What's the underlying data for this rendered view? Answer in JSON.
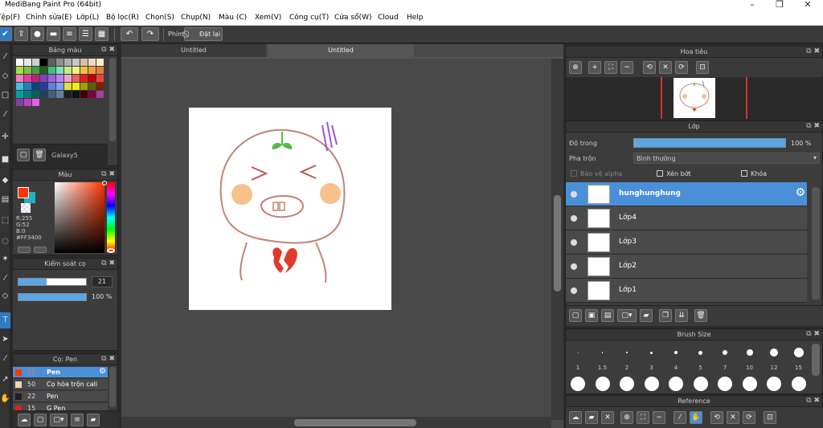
{
  "window": {
    "title": "MediBang Paint Pro (64bit)",
    "minimize": "–",
    "maximize": "❐",
    "close": "✕"
  },
  "menu": [
    "Tệp(F)",
    "Chỉnh sửa(E)",
    "Lớp(L)",
    "Bộ lọc(R)",
    "Chọn(S)",
    "Chụp(N)",
    "Màu (C)",
    "Xem(V)",
    "Công cụ(T)",
    "Cửa sổ(W)",
    "Cloud",
    "Help"
  ],
  "toolbar": {
    "snap_label": "Phím",
    "reset_label": "Đặt lại"
  },
  "tabs": [
    "Untitled",
    "Untitled"
  ],
  "palette": {
    "title": "Bảng màu",
    "set_name": "Galaxy5",
    "colors": [
      [
        "#ffffff",
        "#e8e8e8",
        "#d0d0d0",
        "#000000",
        "#606060",
        "#909090",
        "#b0b0b0",
        "#c8c8c8",
        "#d8c0a0",
        "#f0d8c0",
        "#f8f0c0"
      ],
      [
        "#a0e040",
        "#80c040",
        "#40a040",
        "#206020",
        "#40c080",
        "#80e0c0",
        "#c0f080",
        "#f0f080",
        "#f0c040",
        "#f0a040",
        "#e08040"
      ],
      [
        "#f080c0",
        "#e040a0",
        "#c02080",
        "#8040c0",
        "#a060e0",
        "#c080f0",
        "#f0a0c0",
        "#f06060",
        "#e02020",
        "#c00000",
        "#f04040"
      ],
      [
        "#40c0e0",
        "#2080c0",
        "#104080",
        "#2040a0",
        "#6080e0",
        "#80a0f0",
        "#e0e040",
        "#f0f000",
        "#a0a000",
        "#606000",
        "#802000"
      ],
      [
        "#00a0a0",
        "#008080",
        "#006060",
        "#204060",
        "#406080",
        "#6080a0",
        "#202020",
        "#101010",
        "#400000",
        "#800040",
        "#a040a0"
      ],
      [
        "#8040a0",
        "#c040c0",
        "#e060e0"
      ]
    ]
  },
  "color_panel": {
    "title": "Màu",
    "r": "R:255",
    "g": "G:52",
    "b": "B:0",
    "hex": "#FF3400",
    "primary": "#ff3400",
    "secondary": "#20b0c0"
  },
  "brush_control": {
    "title": "Kiểm soát cọ",
    "size_value": "21",
    "size_fraction": 0.42,
    "opacity_value": "100 %",
    "opacity_fraction": 1.0
  },
  "brush_list": {
    "title": "Cọ: Pen",
    "items": [
      {
        "size": "21",
        "name": "Pen",
        "selected": true,
        "color": "#ff3400"
      },
      {
        "size": "50",
        "name": "Cọ hòa trộn cali",
        "selected": false,
        "color": "#f0d8b0"
      },
      {
        "size": "22",
        "name": "Pen",
        "selected": false,
        "color": "#202020"
      },
      {
        "size": "15",
        "name": "G Pen",
        "selected": false,
        "color": "#e02020"
      }
    ]
  },
  "navigator": {
    "title": "Hoa tiêu"
  },
  "layers": {
    "title": "Lớp",
    "opacity_label": "Độ trong",
    "opacity_value": "100 %",
    "opacity_fraction": 1.0,
    "blend_label": "Pha trộn",
    "blend_value": "Bình thường",
    "protect_alpha": "Bảo vệ alpha",
    "clipping": "Xén bớt",
    "lock": "Khóa",
    "items": [
      {
        "name": "hunghunghung",
        "selected": true
      },
      {
        "name": "Lớp4",
        "selected": false
      },
      {
        "name": "Lớp3",
        "selected": false
      },
      {
        "name": "Lớp2",
        "selected": false
      },
      {
        "name": "Lớp1",
        "selected": false
      }
    ]
  },
  "brush_size": {
    "title": "Brush Size",
    "sizes": [
      "1",
      "1.5",
      "2",
      "3",
      "4",
      "5",
      "7",
      "10",
      "12",
      "15"
    ]
  },
  "reference": {
    "title": "Reference"
  }
}
